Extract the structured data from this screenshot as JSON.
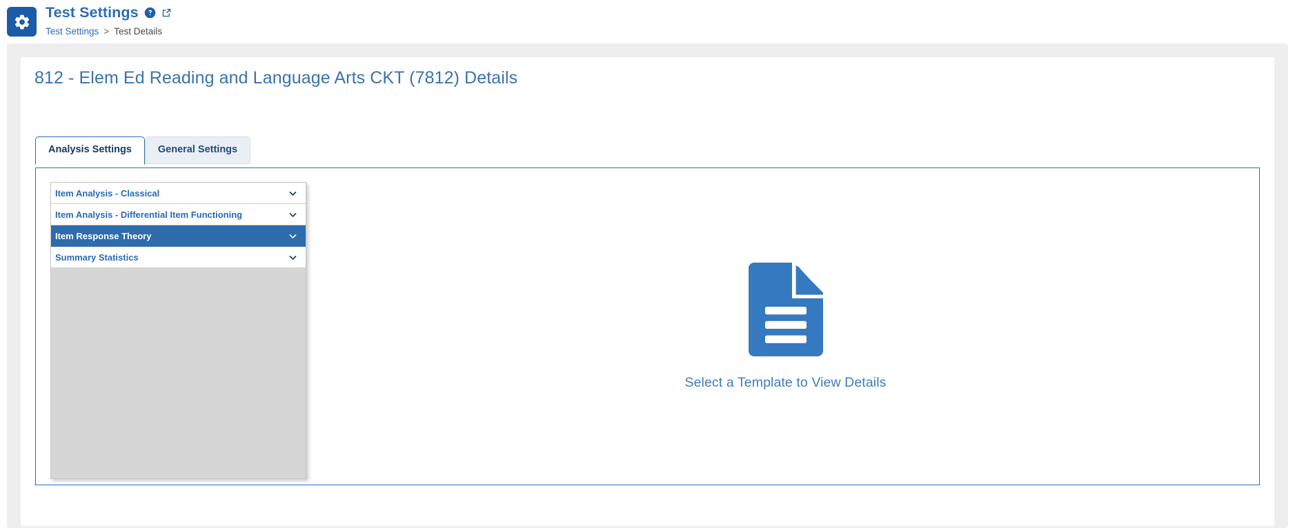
{
  "header": {
    "app_icon": "gear-icon",
    "title": "Test Settings",
    "help_icon": "help-circle-icon",
    "popout_icon": "external-link-icon",
    "breadcrumb": {
      "root": "Test Settings",
      "separator": ">",
      "current": "Test Details"
    }
  },
  "card": {
    "title": "812 - Elem Ed Reading and Language Arts CKT (7812) Details",
    "tabs": [
      {
        "label": "Analysis Settings",
        "active": true
      },
      {
        "label": "General Settings",
        "active": false
      }
    ],
    "accordion": {
      "items": [
        {
          "label": "Item Analysis - Classical",
          "icon": "chevron-down-icon",
          "selected": false
        },
        {
          "label": "Item Analysis - Differential Item Functioning",
          "icon": "chevron-down-icon",
          "selected": false
        },
        {
          "label": "Item Response Theory",
          "icon": "chevron-down-icon",
          "selected": true
        },
        {
          "label": "Summary Statistics",
          "icon": "chevron-down-icon",
          "selected": false
        }
      ]
    },
    "empty_state": {
      "icon": "document-icon",
      "message": "Select a Template to View Details"
    }
  },
  "colors": {
    "brand_blue": "#2b6cb8",
    "icon_tile_blue": "#1c5ba5",
    "selected_row_blue": "#2e6cad",
    "title_blue": "#3a72ae",
    "empty_text_blue": "#3f7cbd",
    "panel_gray": "#d6d6d6",
    "page_gray": "#eeeeee",
    "tab_inactive_bg": "#eaeff5"
  }
}
